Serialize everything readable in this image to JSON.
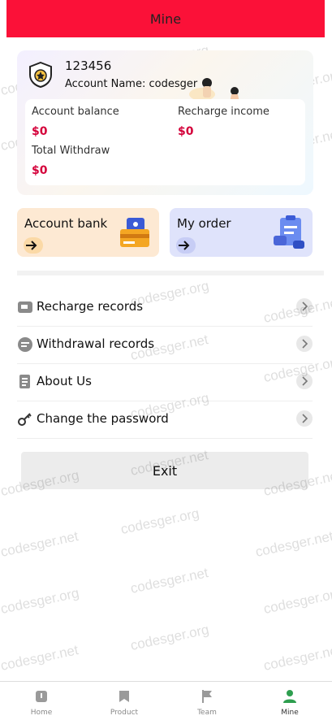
{
  "header": {
    "title": "Mine"
  },
  "profile": {
    "user_id": "123456",
    "account_name": "Account Name: codesger"
  },
  "balances": {
    "account_balance_label": "Account balance",
    "account_balance_value": "$0",
    "recharge_income_label": "Recharge income",
    "recharge_income_value": "$0",
    "total_withdraw_label": "Total Withdraw",
    "total_withdraw_value": "$0"
  },
  "tiles": {
    "bank_label": "Account bank",
    "order_label": "My order"
  },
  "menu": [
    {
      "label": "Recharge records",
      "icon": "recharge-record-icon"
    },
    {
      "label": "Withdrawal records",
      "icon": "withdrawal-record-icon"
    },
    {
      "label": "About Us",
      "icon": "document-icon"
    },
    {
      "label": "Change the password",
      "icon": "key-icon"
    }
  ],
  "exit_label": "Exit",
  "bottom_nav": [
    {
      "label": "Home",
      "icon": "home-icon"
    },
    {
      "label": "Product",
      "icon": "product-icon"
    },
    {
      "label": "Team",
      "icon": "flag-icon"
    },
    {
      "label": "Mine",
      "icon": "user-icon",
      "active": true
    }
  ],
  "watermark_text": [
    "codesger.org",
    "codesger.net"
  ],
  "colors": {
    "header_bg": "#fb1138",
    "amount_color": "#d4003a",
    "active_nav": "#2e9e4f"
  }
}
